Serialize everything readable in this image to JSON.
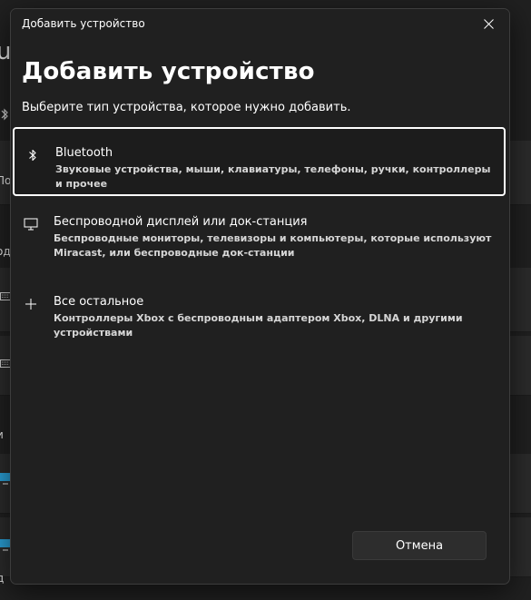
{
  "background": {
    "peek_heading_char": "u",
    "peek_label_1": "По",
    "peek_label_2": "од",
    "peek_label_3": "и",
    "peek_label_4": "д"
  },
  "dialog": {
    "window_title": "Добавить устройство",
    "heading": "Добавить устройство",
    "subtitle": "Выберите тип устройства, которое нужно добавить.",
    "options": [
      {
        "icon": "bluetooth-icon",
        "title": "Bluetooth",
        "description": "Звуковые устройства, мыши, клавиатуры, телефоны, ручки, контроллеры и прочее",
        "selected": true
      },
      {
        "icon": "monitor-icon",
        "title": "Беспроводной дисплей или док-станция",
        "description": "Беспроводные мониторы, телевизоры и компьютеры, которые используют Miracast, или беспроводные док-станции",
        "selected": false
      },
      {
        "icon": "plus-icon",
        "title": "Все остальное",
        "description": "Контроллеры Xbox с беспроводным адаптером Xbox, DLNA и другими устройствами",
        "selected": false
      }
    ],
    "cancel_label": "Отмена"
  },
  "colors": {
    "background": "#202020",
    "selected_border": "#ffffff",
    "button": "#2d2d2d"
  }
}
